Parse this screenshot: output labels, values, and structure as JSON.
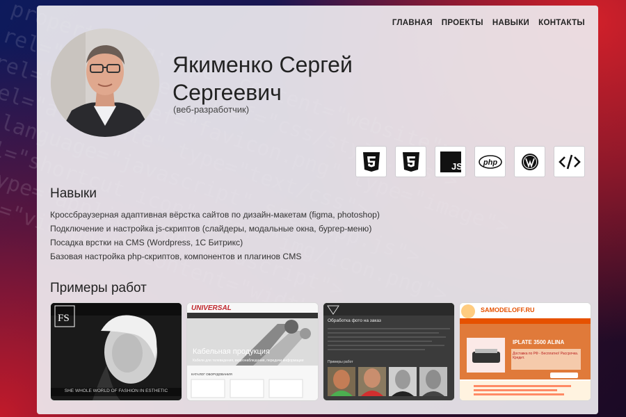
{
  "nav": {
    "items": [
      "ГЛАВНАЯ",
      "ПРОЕКТЫ",
      "НАВЫКИ",
      "КОНТАКТЫ"
    ]
  },
  "profile": {
    "name_line1": "Якименко Сергей",
    "name_line2": "Сергеевич",
    "role": "(веб-разработчик)"
  },
  "tech_icons": [
    "html5-icon",
    "css3-icon",
    "js-icon",
    "php-icon",
    "wordpress-icon",
    "code-icon"
  ],
  "tech_labels": {
    "js": "JS",
    "php": "php"
  },
  "skills": {
    "title": "Навыки",
    "items": [
      "Кроссбраузерная адаптивная вёрстка сайтов по дизайн-макетам (figma, photoshop)",
      "Подключение и настройка js-скриптов (слайдеры, модальные окна, бургер-меню)",
      "Посадка врстки на CMS (Wordpress, 1С Битрикс)",
      "Базовая настройка php-скриптов, компонентов и плагинов CMS"
    ]
  },
  "works": {
    "title": "Примеры работ",
    "items": [
      {
        "caption": "SHE WHOLE WORLD OF FASHION IN ESTHETIC"
      },
      {
        "brand": "UNIVERSAL",
        "headline": "Кабельная продукция",
        "sub": "Кабели для телевидения, видеонаблюдения, передачи информации",
        "section": "КАТАЛОГ ОБОРУДОВАНИЯ"
      },
      {
        "headline": "Обработка фото на заказ",
        "sub": "Примеры работ"
      },
      {
        "brand": "SAMODELOFF.RU",
        "product": "IPLATE 3500 ALINA",
        "note": "Доставка по РФ - Бесплатно! Рассрочка. Кредит."
      }
    ]
  }
}
